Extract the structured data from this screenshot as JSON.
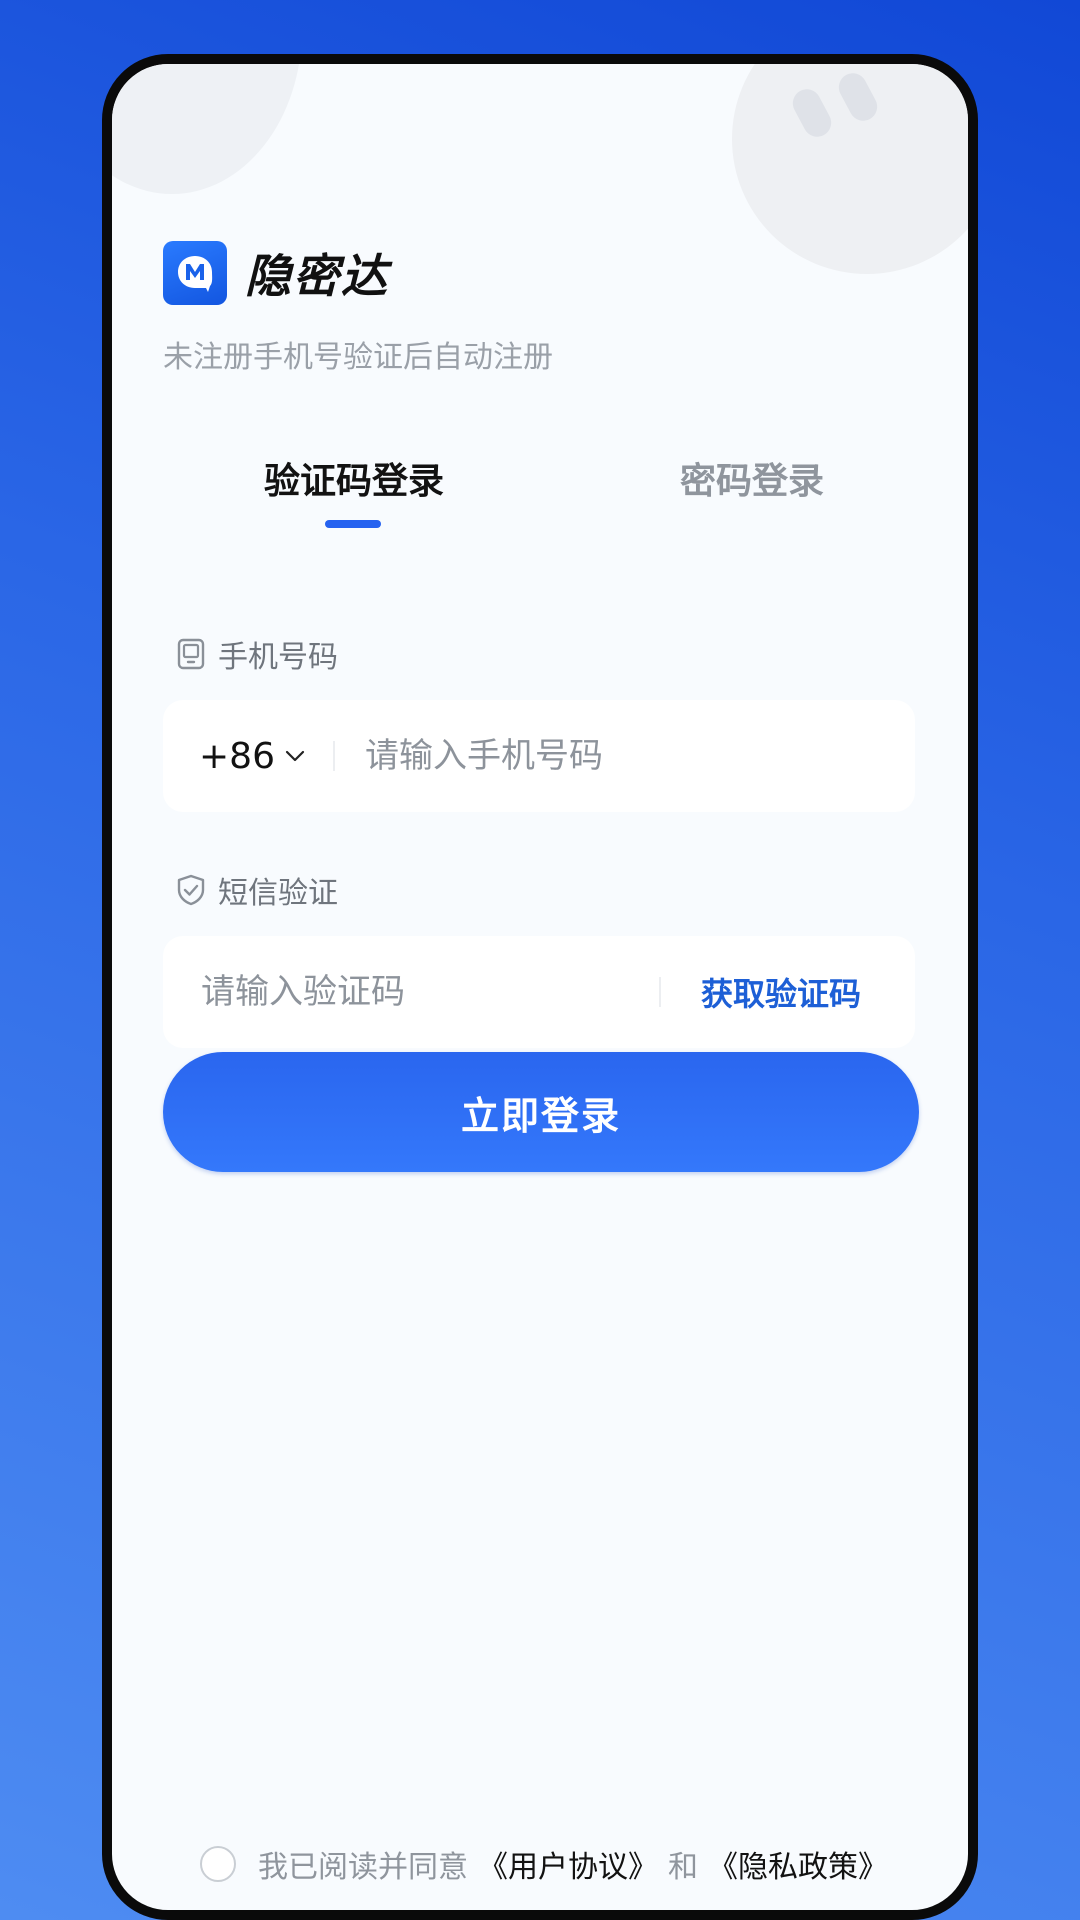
{
  "app": {
    "name": "隐密达",
    "subtitle": "未注册手机号验证后自动注册",
    "accent_color": "#2562f0"
  },
  "tabs": [
    {
      "label": "验证码登录",
      "active": true
    },
    {
      "label": "密码登录",
      "active": false
    }
  ],
  "phone_field": {
    "label": "手机号码",
    "icon": "phone-icon",
    "country_code": "+86",
    "placeholder": "请输入手机号码",
    "value": ""
  },
  "sms_field": {
    "label": "短信验证",
    "icon": "shield-check-icon",
    "placeholder": "请输入验证码",
    "value": "",
    "get_code_label": "获取验证码"
  },
  "login_button": {
    "label": "立即登录"
  },
  "agreement": {
    "checked": false,
    "prefix": "我已阅读并同意",
    "user_agreement": "《用户协议》",
    "conjunction": "和",
    "privacy_policy": "《隐私政策》"
  }
}
